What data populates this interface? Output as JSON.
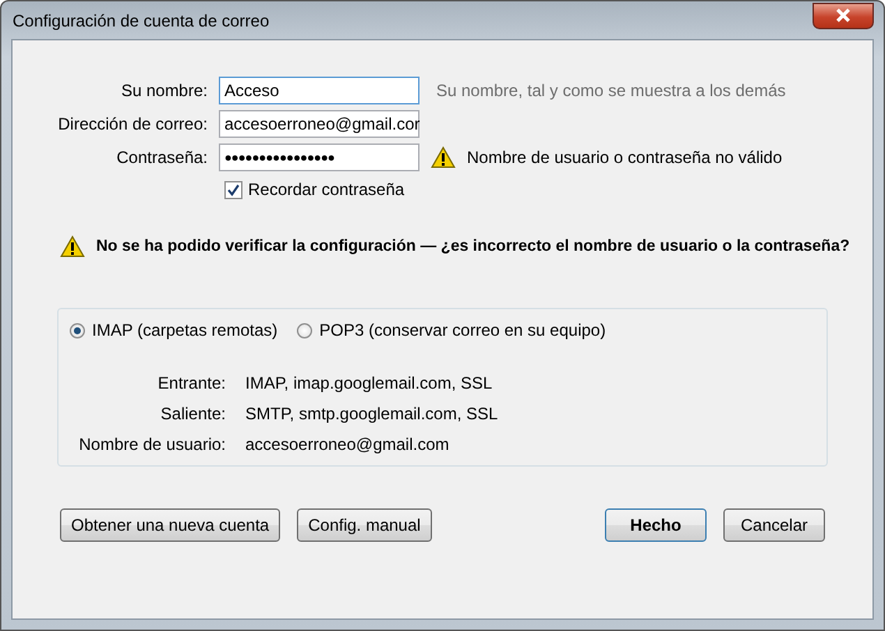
{
  "window": {
    "title": "Configuración de cuenta de correo"
  },
  "fields": [
    {
      "label": "Su nombre:",
      "value": "Acceso",
      "note": {
        "kind": "hint",
        "text": "Su nombre, tal y como se muestra a los demás"
      }
    },
    {
      "label": "Dirección de correo:",
      "value": "accesoerroneo@gmail.cor"
    },
    {
      "label": "Contraseña:",
      "value": "●●●●●●●●●●●●●●●●",
      "note": {
        "kind": "error",
        "text": "Nombre de usuario o contraseña no válido"
      }
    }
  ],
  "remember": {
    "label": "Recordar contraseña",
    "checked": true
  },
  "error_message": "No se ha podido verificar la configuración — ¿es incorrecto el nombre de usuario o la contraseña?",
  "protocols": [
    {
      "label": "IMAP (carpetas remotas)",
      "selected": true
    },
    {
      "label": "POP3 (conservar correo en su equipo)",
      "selected": false
    }
  ],
  "details": [
    {
      "label": "Entrante:",
      "value": "IMAP, imap.googlemail.com, SSL"
    },
    {
      "label": "Saliente:",
      "value": "SMTP, smtp.googlemail.com, SSL"
    },
    {
      "label": "Nombre de usuario:",
      "value": "accesoerroneo@gmail.com"
    }
  ],
  "left_buttons": [
    {
      "label": "Obtener una nueva cuenta",
      "default": false
    },
    {
      "label": "Config. manual",
      "default": false
    }
  ],
  "right_buttons": [
    {
      "label": "Hecho",
      "default": true
    },
    {
      "label": "Cancelar",
      "default": false
    }
  ]
}
